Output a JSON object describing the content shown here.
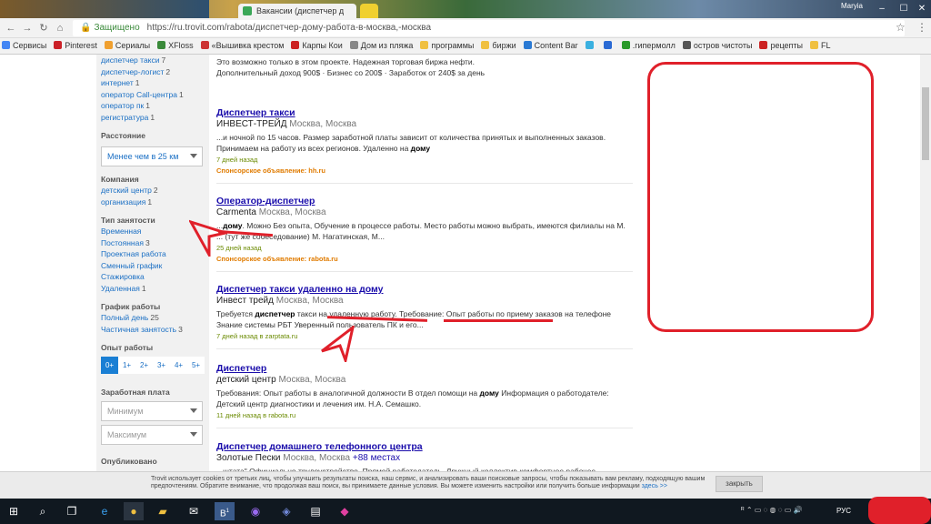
{
  "browser": {
    "tab_title": "Вакансии (диспетчер д",
    "user": "Maryia",
    "secure_label": "Защищено",
    "url": "https://ru.trovit.com/rabota/диспетчер-дому-работа-в-москва,-москва",
    "bookmarks": [
      {
        "label": "Сервисы",
        "color": "#4285f4"
      },
      {
        "label": "Pinterest",
        "color": "#cb2027"
      },
      {
        "label": "Сериалы",
        "color": "#f0a030"
      },
      {
        "label": "XFloss",
        "color": "#3a8a3a"
      },
      {
        "label": "«Вышивка крестом",
        "color": "#cc3333"
      },
      {
        "label": "Карпы Кои",
        "color": "#cc2222"
      },
      {
        "label": "Дом из пляжа",
        "color": "#888888"
      },
      {
        "label": "программы",
        "color": "#f0c040"
      },
      {
        "label": "биржи",
        "color": "#f0c040"
      },
      {
        "label": "Content Bar",
        "color": "#2a7ad4"
      },
      {
        "label": "",
        "color": "#3ab0e0"
      },
      {
        "label": "",
        "color": "#2a6ad4"
      },
      {
        "label": ".гипермолл",
        "color": "#2a9a2a"
      },
      {
        "label": "остров чистоты",
        "color": "#555555"
      },
      {
        "label": "рецепты",
        "color": "#cc2222"
      },
      {
        "label": "FL",
        "color": "#f0c040"
      }
    ]
  },
  "sidebar": {
    "top_items": [
      {
        "label": "диспетчер такси",
        "count": "7"
      },
      {
        "label": "диспетчер-логист",
        "count": "2"
      },
      {
        "label": "интернет",
        "count": "1"
      },
      {
        "label": "оператор Call-центра",
        "count": "1"
      },
      {
        "label": "оператор пк",
        "count": "1"
      },
      {
        "label": "регистратура",
        "count": "1"
      }
    ],
    "distance_heading": "Расстояние",
    "distance_value": "Менее чем в 25 км",
    "company_heading": "Компания",
    "company_items": [
      {
        "label": "детский центр",
        "count": "2"
      },
      {
        "label": "организация",
        "count": "1"
      }
    ],
    "type_heading": "Тип занятости",
    "type_items": [
      {
        "label": "Временная",
        "count": ""
      },
      {
        "label": "Постоянная",
        "count": "3"
      },
      {
        "label": "Проектная работа",
        "count": ""
      },
      {
        "label": "Сменный график",
        "count": ""
      },
      {
        "label": "Стажировка",
        "count": ""
      },
      {
        "label": "Удаленная",
        "count": "1"
      }
    ],
    "schedule_heading": "График работы",
    "schedule_items": [
      {
        "label": "Полный день",
        "count": "25"
      },
      {
        "label": "Частичная занятость",
        "count": "3"
      }
    ],
    "experience_heading": "Опыт работы",
    "experience": [
      "0+",
      "1+",
      "2+",
      "3+",
      "4+",
      "5+"
    ],
    "salary_heading": "Заработная плата",
    "salary_min": "Минимум",
    "salary_max": "Максимум",
    "published_heading": "Опубликовано"
  },
  "results": {
    "partial_top_line1": "Это возможно только в этом проекте. Надежная торговая биржа нефти.",
    "partial_top_line2": "Дополнительный доход 900$ · Бизнес со 200$ · Заработок от 240$ за день",
    "items": [
      {
        "title": "Диспетчер такси",
        "company": "ИНВЕСТ-ТРЕЙД",
        "location": "Москва, Москва",
        "more": "",
        "desc_pre": "...и ночной по 15 часов. Размер заработной платы зависит от количества принятых и выполненных заказов. Принимаем на работу из всех регионов. Удаленно на ",
        "desc_bold": "дому",
        "desc_post": "",
        "age": "7 дней назад",
        "sponsor": "Спонсорское объявление: hh.ru"
      },
      {
        "title": "Оператор-диспетчер",
        "company": "Carmenta",
        "location": "Москва, Москва",
        "more": "",
        "desc_pre": "...",
        "desc_bold": "дому",
        "desc_post": ". Можно Без опыта, Обучение в процессе работы. Место работы можно выбрать, имеются филиалы на М. ... (тут же собеседование) М. Нагатинская, М...",
        "age": "25 дней назад",
        "sponsor": "Спонсорское объявление: rabota.ru"
      },
      {
        "title": "Диспетчер такси удаленно на дому",
        "company": "Инвест трейд",
        "location": "Москва, Москва",
        "more": "",
        "desc_pre": "Требуется ",
        "desc_bold": "диспетчер",
        "desc_post": " такси на удаленную работу. Требование: Опыт работы по приему заказов на телефоне Знание системы РБТ Уверенный пользователь ПК и его...",
        "age": "7 дней назад в zarptata.ru",
        "sponsor": ""
      },
      {
        "title": "Диспетчер",
        "company": "детский центр",
        "location": "Москва, Москва",
        "more": "",
        "desc_pre": "Требования: Опыт работы в аналогичной должности В отдел помощи на ",
        "desc_bold": "дому",
        "desc_post": " Информация о работодателе: Детский центр диагностики и лечения им. Н.А. Семашко.",
        "age": "11 дней назад в rabota.ru",
        "sponsor": ""
      },
      {
        "title": "Диспетчер домашнего телефонного центра",
        "company": "Золотые Пески",
        "location": "Москва, Москва",
        "more": "+88 местах",
        "desc_pre": "...штата\" Официально трудоустройство. Прямой работодатель. Дружный коллектив комфортное рабочее...",
        "desc_bold": "",
        "desc_post": "",
        "age": "",
        "sponsor": ""
      }
    ]
  },
  "cookie": {
    "text": "Trovit использует cookies от третьих лиц, чтобы улучшить результаты поиска, наш сервис, и анализировать ваши поисковые запросы, чтобы показывать вам рекламу, подходящую вашим предпочтениям. Обратите внимание, что продолжая ваш поиск, вы принимаете данные условия. Вы можете изменить настройки или получить больше информации ",
    "link": "здесь >>",
    "close": "закрыть"
  },
  "taskbar": {
    "lang": "РУС",
    "badge": "1"
  },
  "colors": {
    "annotation_red": "#e0202a",
    "link_blue": "#1a0dab",
    "sponsor_orange": "#e07b00"
  }
}
